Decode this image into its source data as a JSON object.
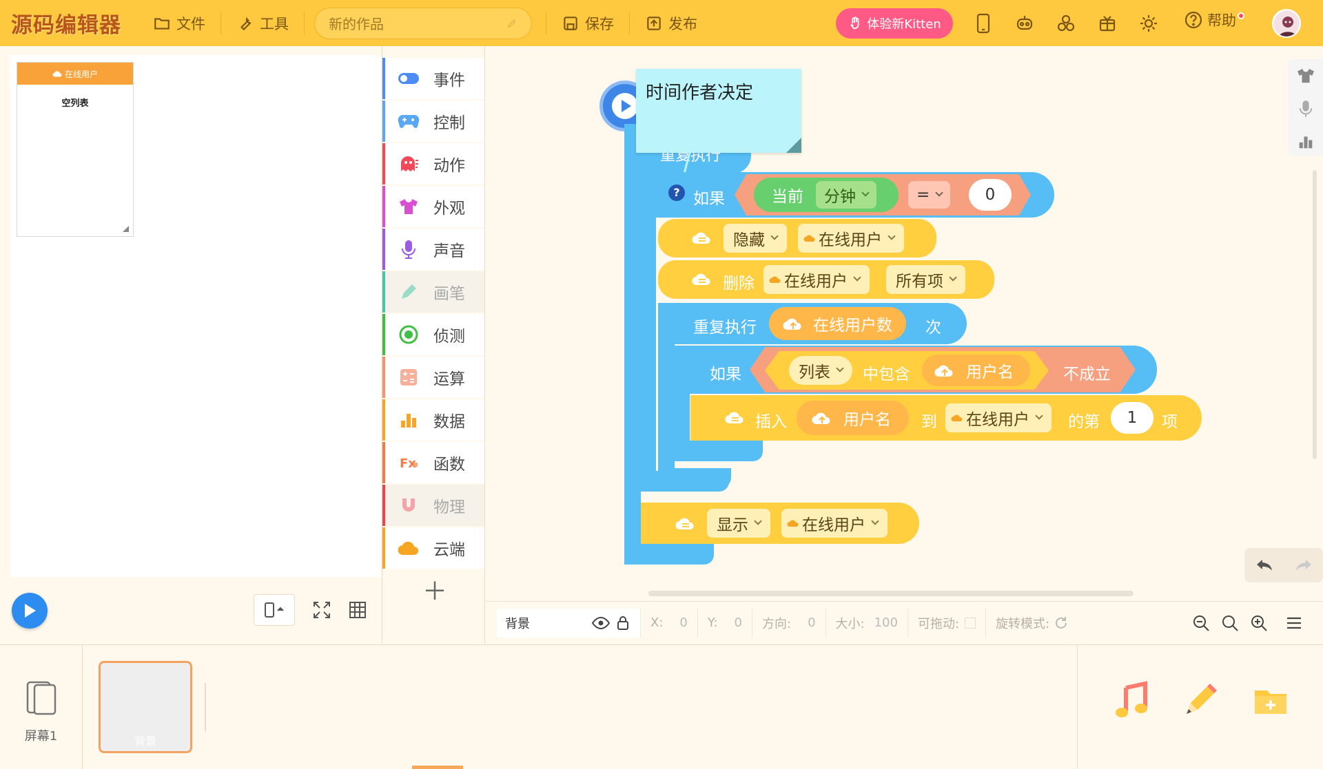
{
  "topbar": {
    "logo": "源码编辑器",
    "file": "文件",
    "tools": "工具",
    "title_placeholder": "新的作品",
    "save": "保存",
    "publish": "发布",
    "kitten": "体验新Kitten",
    "help": "帮助"
  },
  "stage": {
    "list_widget": {
      "title": "在线用户",
      "empty_text": "空列表"
    }
  },
  "palette": {
    "categories": [
      {
        "label": "事件",
        "color": "#4b8cf5"
      },
      {
        "label": "控制",
        "color": "#58a8f5"
      },
      {
        "label": "动作",
        "color": "#f04a5a"
      },
      {
        "label": "外观",
        "color": "#d84fd2"
      },
      {
        "label": "声音",
        "color": "#9a5ce0"
      },
      {
        "label": "画笔",
        "color": "#45c8a8"
      },
      {
        "label": "侦测",
        "color": "#3fbf44"
      },
      {
        "label": "运算",
        "color": "#f59272"
      },
      {
        "label": "数据",
        "color": "#f6a623"
      },
      {
        "label": "函数",
        "color": "#f07c48"
      },
      {
        "label": "物理",
        "color": "#e8454f"
      },
      {
        "label": "云端",
        "color": "#f6a623"
      }
    ]
  },
  "workspace": {
    "comment": "时间作者决定",
    "repeat_forever_label": "重复执行",
    "if_block": {
      "if": "如果",
      "current": "当前",
      "unit": "分钟",
      "op": "=",
      "value": "0"
    },
    "hide": {
      "action": "隐藏",
      "var": "在线用户"
    },
    "delete": {
      "action": "删除",
      "var": "在线用户",
      "which": "所有项"
    },
    "repeat_n": {
      "label": "重复执行",
      "count_var": "在线用户数",
      "suffix": "次"
    },
    "if2": {
      "if": "如果",
      "list": "列表",
      "contains": "中包含",
      "item": "用户名",
      "neg": "不成立"
    },
    "insert": {
      "action": "插入",
      "item": "用户名",
      "to": "到",
      "list": "在线用户",
      "pos_prefix": "的第",
      "pos": "1",
      "pos_suffix": "项"
    },
    "show": {
      "action": "显示",
      "var": "在线用户"
    }
  },
  "propbar": {
    "sprite_name": "背景",
    "x_label": "X:",
    "x": "0",
    "y_label": "Y:",
    "y": "0",
    "dir_label": "方向:",
    "dir": "0",
    "size_label": "大小:",
    "size": "100",
    "drag_label": "可拖动:",
    "rot_label": "旋转模式:"
  },
  "bottombar": {
    "screen_label": "屏幕1",
    "sprite_label": "背景"
  }
}
